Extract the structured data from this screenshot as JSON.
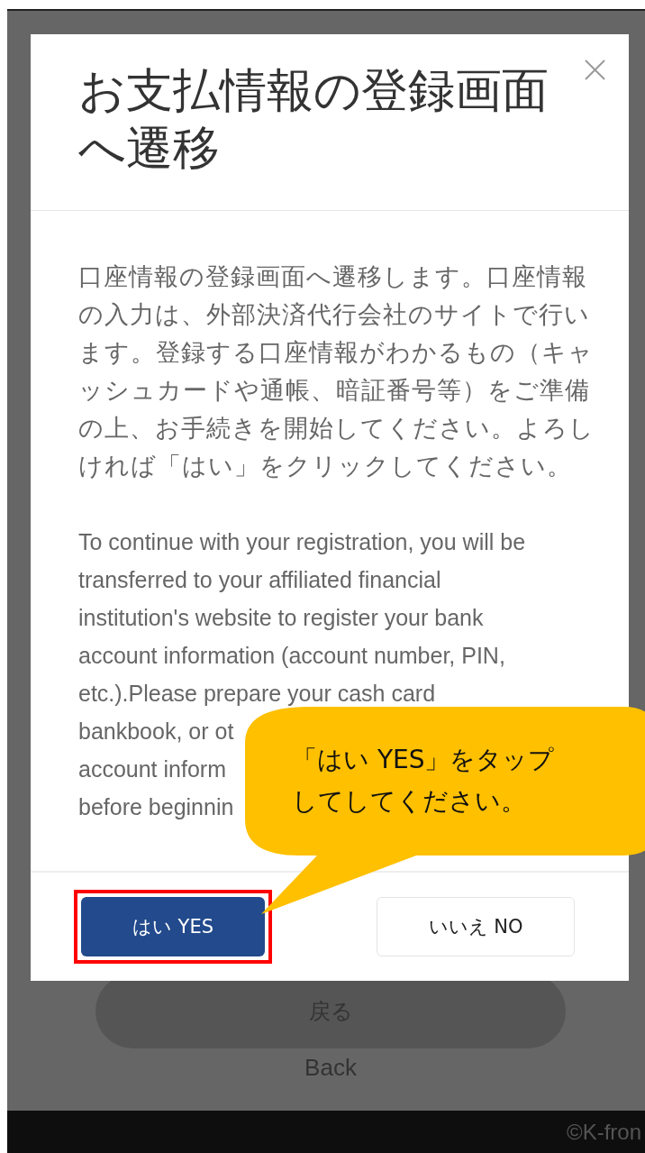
{
  "dialog": {
    "title": "お支払情報の登録画面へ遷移",
    "message_ja": "口座情報の登録画面へ遷移します。口座情報の入力は、外部決済代行会社のサイトで行います。登録する口座情報がわかるもの（キャッシュカードや通帳、暗証番号等）をご準備の上、お手続きを開始してください。よろしければ「はい」をクリックしてください。",
    "message_en_lines": [
      "To continue with your registration, you will be",
      "transferred to your affiliated financial",
      "institution's website to register your bank",
      "account information (account number, PIN,",
      "etc.).Please prepare your cash card"
    ],
    "message_en_cut_lines": [
      "bankbook, or ot",
      "account inform",
      "before beginnin"
    ],
    "buttons": [
      {
        "label": "はい YES",
        "kind": "primary",
        "highlighted": true
      },
      {
        "label": "いいえ NO",
        "kind": "secondary",
        "highlighted": false
      }
    ]
  },
  "background": {
    "back_button": "戻る",
    "back_label": "Back"
  },
  "callout": {
    "lines": [
      "「はい YES」をタップ",
      "してしてください。"
    ]
  },
  "footer": {
    "copyright": "©K-fron"
  }
}
